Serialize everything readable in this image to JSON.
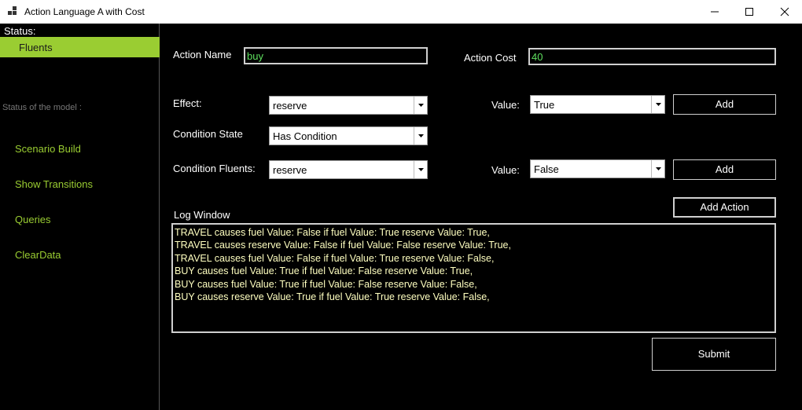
{
  "window": {
    "title": "Action Language A with Cost",
    "controls": [
      "minimize-icon",
      "maximize-icon",
      "close-icon"
    ]
  },
  "sidebar": {
    "status_label": "Status:",
    "fluents_label": "Fluents",
    "model_status_label": "Status of the model :",
    "nav_items": [
      {
        "label": "Scenario Build"
      },
      {
        "label": "Show Transitions"
      },
      {
        "label": "Queries"
      },
      {
        "label": "ClearData"
      }
    ]
  },
  "form": {
    "action_name_label": "Action Name",
    "action_name_value": "buy",
    "action_cost_label": "Action Cost",
    "action_cost_value": "40",
    "effect_label": "Effect:",
    "effect_value": "reserve",
    "effect_value_label": "Value:",
    "effect_value_selected": "True",
    "add_effect_label": "Add",
    "condition_state_label": "Condition State",
    "condition_state_value": "Has Condition",
    "condition_fluents_label": "Condition Fluents:",
    "condition_fluents_value": "reserve",
    "condition_value_label": "Value:",
    "condition_value_selected": "False",
    "add_condition_label": "Add",
    "add_action_label": "Add Action",
    "submit_label": "Submit"
  },
  "log": {
    "label": "Log Window",
    "lines": [
      "TRAVEL causes fuel Value: False if fuel Value: True reserve Value: True,",
      "TRAVEL causes reserve Value: False if fuel Value: False reserve Value: True,",
      "TRAVEL causes fuel Value: False if fuel Value: True reserve Value: False,",
      "BUY causes fuel Value: True if fuel Value: False reserve Value: True,",
      "BUY causes fuel Value: True if fuel Value: False reserve Value: False,",
      "BUY causes reserve Value: True if fuel Value: True reserve Value: False,"
    ]
  },
  "colors": {
    "accent": "#9acd32",
    "textbox_text": "#5fe05f",
    "log_text": "#ffffc0",
    "background": "#000000"
  }
}
